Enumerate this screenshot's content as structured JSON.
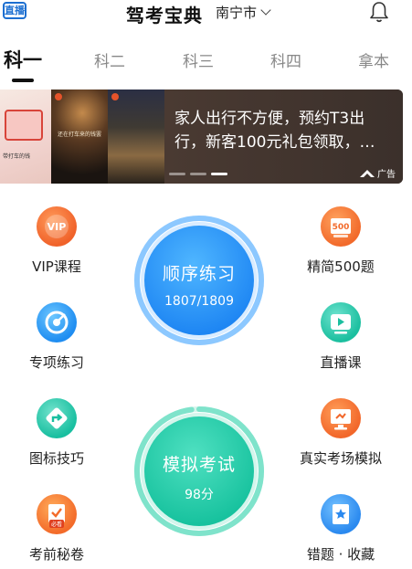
{
  "header": {
    "live_badge": "直播",
    "title": "驾考宝典",
    "city": "南宁市"
  },
  "tabs": [
    {
      "label": "科一",
      "active": true
    },
    {
      "label": "科二",
      "active": false
    },
    {
      "label": "科三",
      "active": false
    },
    {
      "label": "科四",
      "active": false
    },
    {
      "label": "拿本",
      "active": false
    }
  ],
  "banner": {
    "thumb1_caption": "带打车的钱",
    "thumb2_caption": "还在打车来的钱罢",
    "lines": [
      "家人出行不方便，预约T3出",
      "行，新客100元礼包领取，…"
    ],
    "ad_label": "广告",
    "active_dot": 2
  },
  "features": {
    "vip": "VIP课程",
    "select500": "精简500题",
    "special": "专项练习",
    "live": "直播课",
    "signs": "图标技巧",
    "real_sim": "真实考场模拟",
    "secret": "考前秘卷",
    "wrong": "错题 · 收藏",
    "vip_icon_text": "VIP",
    "select500_icon_text": "500",
    "secret_icon_text": "必看"
  },
  "order_practice": {
    "label": "顺序练习",
    "progress_text": "1807/1809",
    "done": 1807,
    "total": 1809
  },
  "mock_exam": {
    "label": "模拟考试",
    "score_text": "98分",
    "score": 98,
    "max": 100
  },
  "colors": {
    "blue": "#1e86f3",
    "teal": "#17c29e",
    "orange": "#f26a2b"
  }
}
